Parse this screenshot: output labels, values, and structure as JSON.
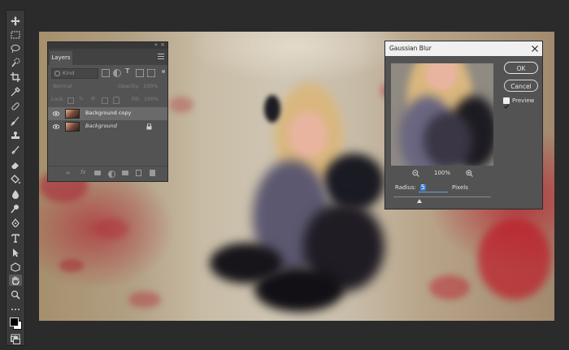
{
  "toolbar": {
    "tools": [
      "move-tool",
      "marquee-tool",
      "lasso-tool",
      "quick-selection-tool",
      "crop-tool",
      "eyedropper-tool",
      "healing-brush-tool",
      "brush-tool",
      "clone-stamp-tool",
      "history-brush-tool",
      "eraser-tool",
      "paint-bucket-tool",
      "blur-tool",
      "dodge-tool",
      "pen-tool",
      "type-tool",
      "path-selection-tool",
      "shape-tool",
      "hand-tool",
      "zoom-tool",
      "more-tools"
    ]
  },
  "layers_panel": {
    "tab_label": "Layers",
    "filter_placeholder": "Kind",
    "blend_mode": "Normal",
    "opacity_label": "Opacity:",
    "opacity_value": "100%",
    "lock_label": "Lock:",
    "fill_label": "Fill:",
    "fill_value": "100%",
    "layers": [
      {
        "name": "Background copy",
        "selected": true,
        "visible": true,
        "locked": false
      },
      {
        "name": "Background",
        "selected": false,
        "visible": true,
        "locked": true
      }
    ]
  },
  "gaussian_blur": {
    "title": "Gaussian Blur",
    "ok_label": "OK",
    "cancel_label": "Cancel",
    "preview_label": "Preview",
    "preview_checked": true,
    "zoom_label": "100%",
    "radius_label": "Radius:",
    "radius_value": "5",
    "unit_label": "Pixels",
    "radius_slider_fraction": 0.27
  },
  "colors": {
    "workspace": "#2b2b2b",
    "panel": "#535353",
    "accent": "#4aa3ff"
  }
}
